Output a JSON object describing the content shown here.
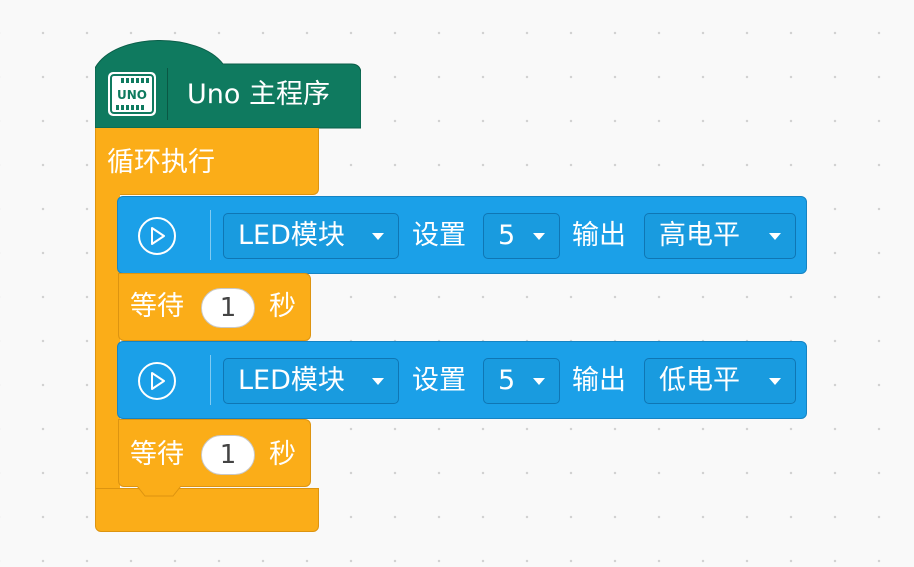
{
  "hat": {
    "icon": "uno-board-icon",
    "icon_text": "UNO",
    "label": "Uno 主程序",
    "color": "#0f7a5f"
  },
  "loop": {
    "label": "循环执行",
    "color": "#fbad18"
  },
  "blocks": [
    {
      "type": "led",
      "icon": "play-circle-icon",
      "module": "LED模块",
      "set_label": "设置",
      "pin": "5",
      "output_label": "输出",
      "level": "高电平"
    },
    {
      "type": "wait",
      "label": "等待",
      "value": "1",
      "unit": "秒"
    },
    {
      "type": "led",
      "icon": "play-circle-icon",
      "module": "LED模块",
      "set_label": "设置",
      "pin": "5",
      "output_label": "输出",
      "level": "低电平"
    },
    {
      "type": "wait",
      "label": "等待",
      "value": "1",
      "unit": "秒"
    }
  ],
  "colors": {
    "led_block": "#1ba0e8",
    "control_block": "#fbad18",
    "hat_block": "#0f7a5f",
    "background": "#f9f9f9"
  }
}
